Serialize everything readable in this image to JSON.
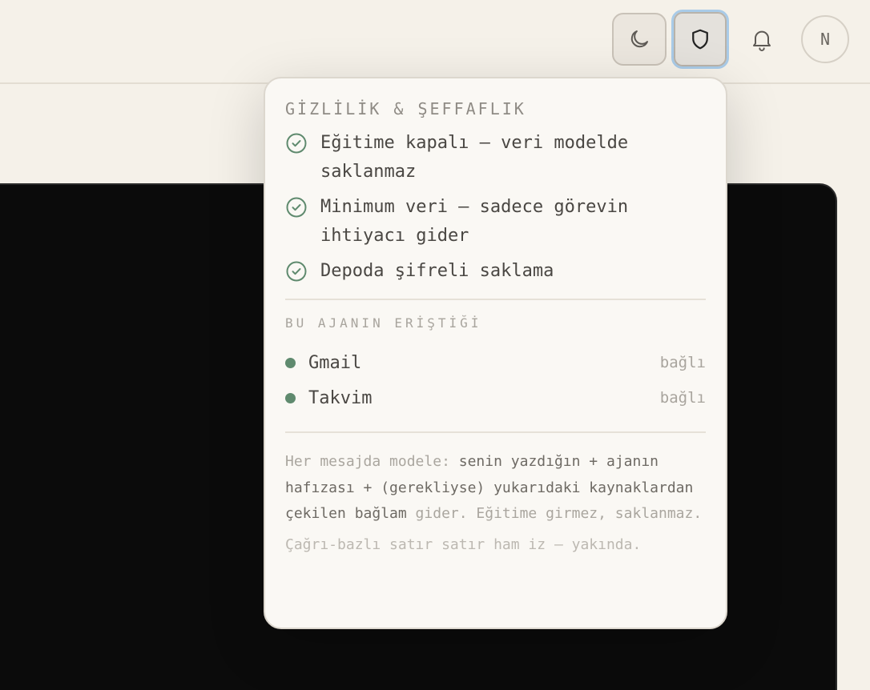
{
  "topbar": {
    "theme_button": {
      "icon": "moon-icon"
    },
    "privacy_button": {
      "icon": "shield-icon"
    },
    "notifications_button": {
      "icon": "bell-icon"
    },
    "avatar_initial": "N"
  },
  "popover": {
    "title": "GİZLİLİK & ŞEFFAFLIK",
    "checks": [
      {
        "label": "Eğitime kapalı — veri modelde saklanmaz"
      },
      {
        "label": "Minimum veri — sadece görevin ihtiyacı gider"
      },
      {
        "label": "Depoda şifreli saklama"
      }
    ],
    "sources_label": "BU AJANIN ERİŞTİĞİ",
    "sources": [
      {
        "name": "Gmail",
        "status": "bağlı"
      },
      {
        "name": "Takvim",
        "status": "bağlı"
      }
    ],
    "info": {
      "part1": "Her mesajda modele: ",
      "part2": "senin yazdığın + ajanın hafızası + (gerekliyse) yukarıdaki kaynaklardan çekilen bağlam",
      "part3": " gider. Eğitime girmez, saklanmaz."
    },
    "coming_soon": "Çağrı-bazlı satır satır ham iz — yakında."
  },
  "colors": {
    "accent_green": "#5f8a6e",
    "focus_ring": "#a9cbe8",
    "background": "#f5f1e9"
  }
}
